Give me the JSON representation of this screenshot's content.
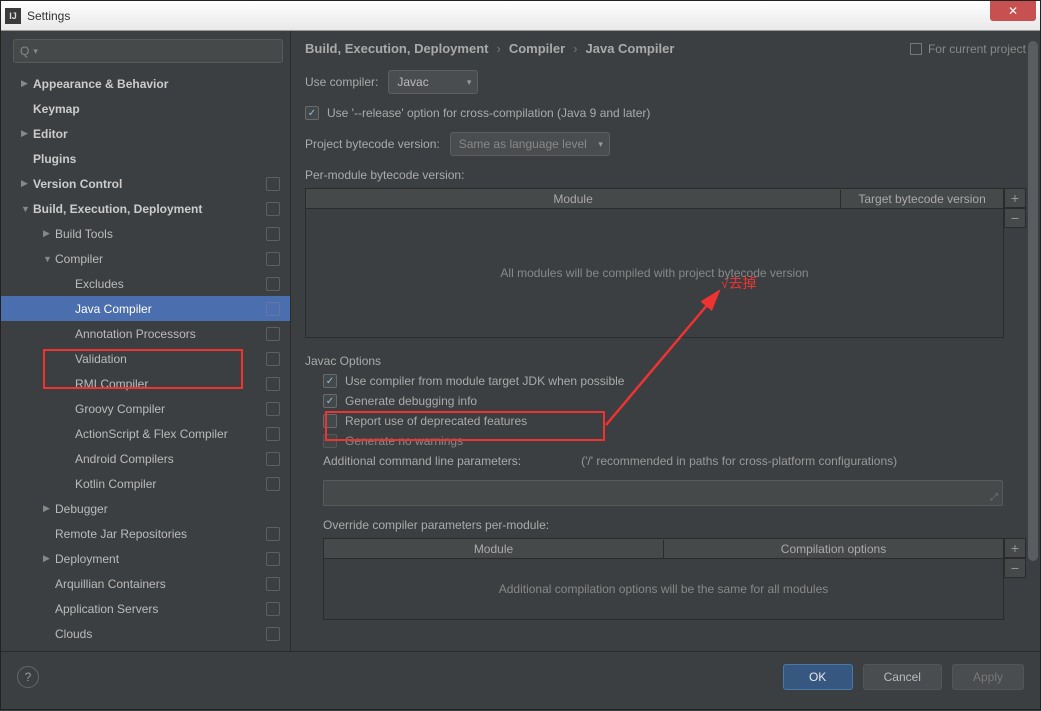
{
  "window": {
    "title": "Settings"
  },
  "search": {
    "placeholder": ""
  },
  "tree": [
    {
      "label": "Appearance & Behavior",
      "lvl": 1,
      "bold": true,
      "arrow": "▶",
      "roll": false
    },
    {
      "label": "Keymap",
      "lvl": 1,
      "bold": true,
      "arrow": "",
      "roll": false
    },
    {
      "label": "Editor",
      "lvl": 1,
      "bold": true,
      "arrow": "▶",
      "roll": false
    },
    {
      "label": "Plugins",
      "lvl": 1,
      "bold": true,
      "arrow": "",
      "roll": false
    },
    {
      "label": "Version Control",
      "lvl": 1,
      "bold": true,
      "arrow": "▶",
      "roll": true
    },
    {
      "label": "Build, Execution, Deployment",
      "lvl": 1,
      "bold": true,
      "arrow": "▼",
      "roll": true
    },
    {
      "label": "Build Tools",
      "lvl": 2,
      "bold": false,
      "arrow": "▶",
      "roll": true
    },
    {
      "label": "Compiler",
      "lvl": 2,
      "bold": false,
      "arrow": "▼",
      "roll": true
    },
    {
      "label": "Excludes",
      "lvl": 3,
      "bold": false,
      "arrow": "",
      "roll": true
    },
    {
      "label": "Java Compiler",
      "lvl": 3,
      "bold": false,
      "arrow": "",
      "roll": true,
      "sel": true
    },
    {
      "label": "Annotation Processors",
      "lvl": 3,
      "bold": false,
      "arrow": "",
      "roll": true
    },
    {
      "label": "Validation",
      "lvl": 3,
      "bold": false,
      "arrow": "",
      "roll": true
    },
    {
      "label": "RMI Compiler",
      "lvl": 3,
      "bold": false,
      "arrow": "",
      "roll": true
    },
    {
      "label": "Groovy Compiler",
      "lvl": 3,
      "bold": false,
      "arrow": "",
      "roll": true
    },
    {
      "label": "ActionScript & Flex Compiler",
      "lvl": 3,
      "bold": false,
      "arrow": "",
      "roll": true
    },
    {
      "label": "Android Compilers",
      "lvl": 3,
      "bold": false,
      "arrow": "",
      "roll": true
    },
    {
      "label": "Kotlin Compiler",
      "lvl": 3,
      "bold": false,
      "arrow": "",
      "roll": true
    },
    {
      "label": "Debugger",
      "lvl": 2,
      "bold": false,
      "arrow": "▶",
      "roll": false
    },
    {
      "label": "Remote Jar Repositories",
      "lvl": 2,
      "bold": false,
      "arrow": "",
      "roll": true
    },
    {
      "label": "Deployment",
      "lvl": 2,
      "bold": false,
      "arrow": "▶",
      "roll": true
    },
    {
      "label": "Arquillian Containers",
      "lvl": 2,
      "bold": false,
      "arrow": "",
      "roll": true
    },
    {
      "label": "Application Servers",
      "lvl": 2,
      "bold": false,
      "arrow": "",
      "roll": true
    },
    {
      "label": "Clouds",
      "lvl": 2,
      "bold": false,
      "arrow": "",
      "roll": true
    }
  ],
  "breadcrumb": {
    "p1": "Build, Execution, Deployment",
    "p2": "Compiler",
    "p3": "Java Compiler",
    "scope": "For current project"
  },
  "form": {
    "use_compiler_label": "Use compiler:",
    "use_compiler_value": "Javac",
    "release_opt": "Use '--release' option for cross-compilation (Java 9 and later)",
    "bytecode_label": "Project bytecode version:",
    "bytecode_value": "Same as language level",
    "per_module_label": "Per-module bytecode version:",
    "table1": {
      "col1": "Module",
      "col2": "Target bytecode version",
      "empty": "All modules will be compiled with project bytecode version"
    },
    "javac_options": "Javac Options",
    "opt1": "Use compiler from module target JDK when possible",
    "opt2": "Generate debugging info",
    "opt3": "Report use of deprecated features",
    "opt4": "Generate no warnings",
    "cmdline_label": "Additional command line parameters:",
    "cmdline_hint": "('/' recommended in paths for cross-platform configurations)",
    "override_label": "Override compiler parameters per-module:",
    "table2": {
      "col1": "Module",
      "col2": "Compilation options",
      "empty": "Additional compilation options will be the same for all modules"
    }
  },
  "footer": {
    "ok": "OK",
    "cancel": "Cancel",
    "apply": "Apply"
  },
  "annotation": {
    "text": "√去掉"
  }
}
